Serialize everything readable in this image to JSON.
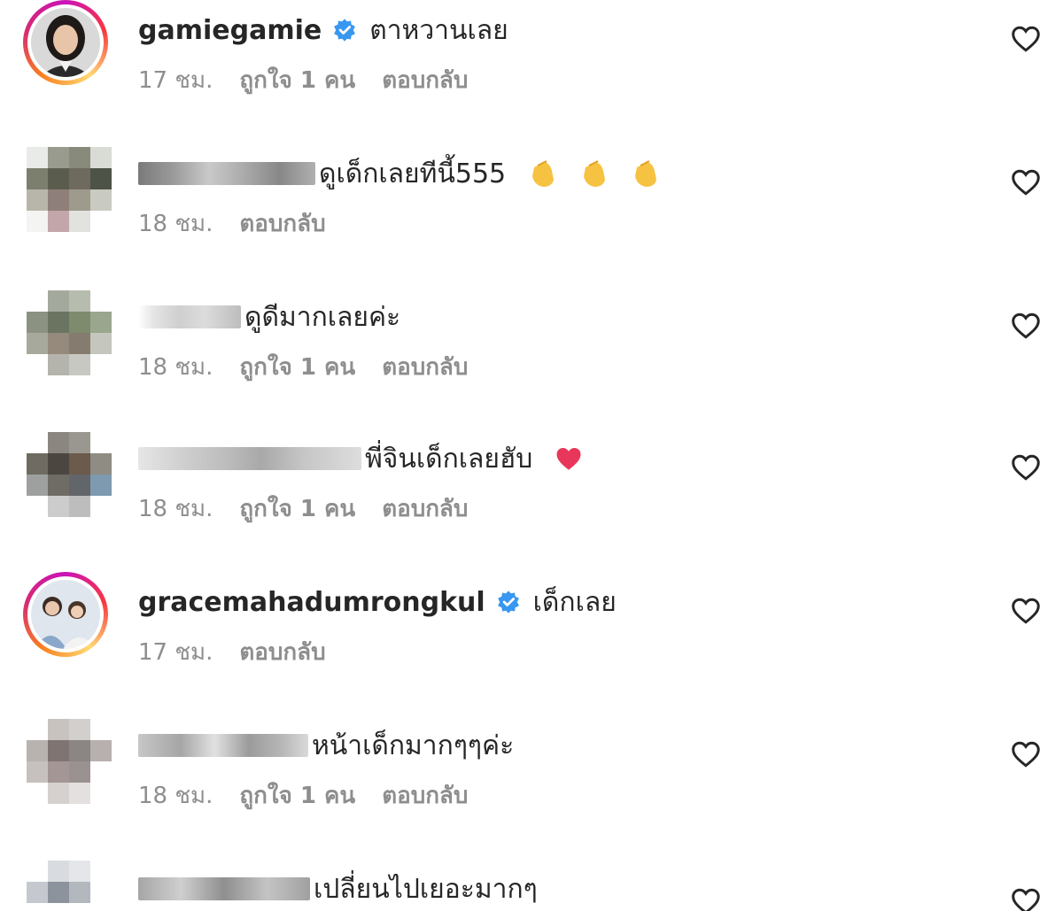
{
  "comments": [
    {
      "username": "gamiegamie",
      "verified": true,
      "text": "ตาหวานเลย",
      "time": "17 ชม.",
      "likes": "ถูกใจ 1 คน",
      "reply": "ตอบกลับ"
    },
    {
      "username": "",
      "verified": false,
      "text": "ดูเด็กเลยทีนี้555",
      "time": "18 ชม.",
      "likes": "",
      "reply": "ตอบกลับ",
      "emoji": "clapping-hands"
    },
    {
      "username": "",
      "verified": false,
      "text": "ดูดีมากเลยค่ะ",
      "time": "18 ชม.",
      "likes": "ถูกใจ 1 คน",
      "reply": "ตอบกลับ"
    },
    {
      "username": "",
      "verified": false,
      "text": "พี่จินเด็กเลยฮับ",
      "time": "18 ชม.",
      "likes": "ถูกใจ 1 คน",
      "reply": "ตอบกลับ",
      "emoji": "red-heart"
    },
    {
      "username": "gracemahadumrongkul",
      "verified": true,
      "text": "เด็กเลย",
      "time": "17 ชม.",
      "likes": "",
      "reply": "ตอบกลับ"
    },
    {
      "username": "",
      "verified": false,
      "text": "หน้าเด็กมากๆๆค่ะ",
      "time": "18 ชม.",
      "likes": "ถูกใจ 1 คน",
      "reply": "ตอบกลับ"
    },
    {
      "username": "",
      "verified": false,
      "text": "เปลี่ยนไปเยอะมากๆ",
      "time": "",
      "likes": "",
      "reply": ""
    }
  ],
  "colors": {
    "text": "#262626",
    "meta": "#8e8e8e",
    "verified": "#3897f0",
    "heart_outline": "#262626"
  },
  "icons": {
    "like": "heart-outline-icon",
    "verified": "verified-badge-icon"
  }
}
